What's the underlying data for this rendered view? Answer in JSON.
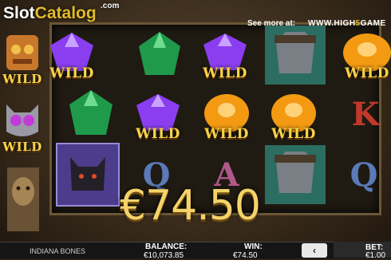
{
  "branding": {
    "logo_slot": "Slot",
    "logo_catalog": "Catalog",
    "logo_com": ".com"
  },
  "promo": {
    "see_more": "See more at:",
    "site_pre": "WWW.HIGH",
    "site_five": "5",
    "site_post": "GAME"
  },
  "reels": {
    "wild": "WILD",
    "letters": {
      "q": "Q",
      "a": "A",
      "k": "K"
    }
  },
  "win_display": {
    "amount": "€74.50"
  },
  "bottom": {
    "game_name": "INDIANA BONES",
    "balance_label": "BALANCE:",
    "balance_value": "€10,073.85",
    "win_label": "WIN:",
    "win_value": "€74.50",
    "bet_label": "BET:",
    "bet_value": "€1.00",
    "prev_icon": "‹"
  },
  "colors": {
    "gold": "#f7d34a",
    "purple_gem": "#8a3ef0",
    "green_gem": "#1f9a4a",
    "orange_gem": "#f39a12"
  }
}
